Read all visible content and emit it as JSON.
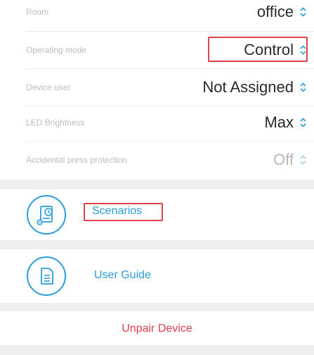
{
  "settings": {
    "room": {
      "label": "Room",
      "value": "office"
    },
    "operating_mode": {
      "label": "Operating mode",
      "value": "Control"
    },
    "device_user": {
      "label": "Device user",
      "value": "Not Assigned"
    },
    "led_brightness": {
      "label": "LED Brightness",
      "value": "Max"
    },
    "accidental_press": {
      "label": "Accidental press protection",
      "value": "Off"
    }
  },
  "menu": {
    "scenarios_label": "Scenarios",
    "user_guide_label": "User Guide",
    "unpair_label": "Unpair Device"
  },
  "colors": {
    "accent": "#2a9ed9",
    "highlight": "#e0424c",
    "danger": "#e0424c",
    "band": "#efefef"
  },
  "icons": {
    "chevron": "up-down-chevron-icon",
    "scenarios": "scenarios-icon",
    "user_guide": "document-icon"
  }
}
